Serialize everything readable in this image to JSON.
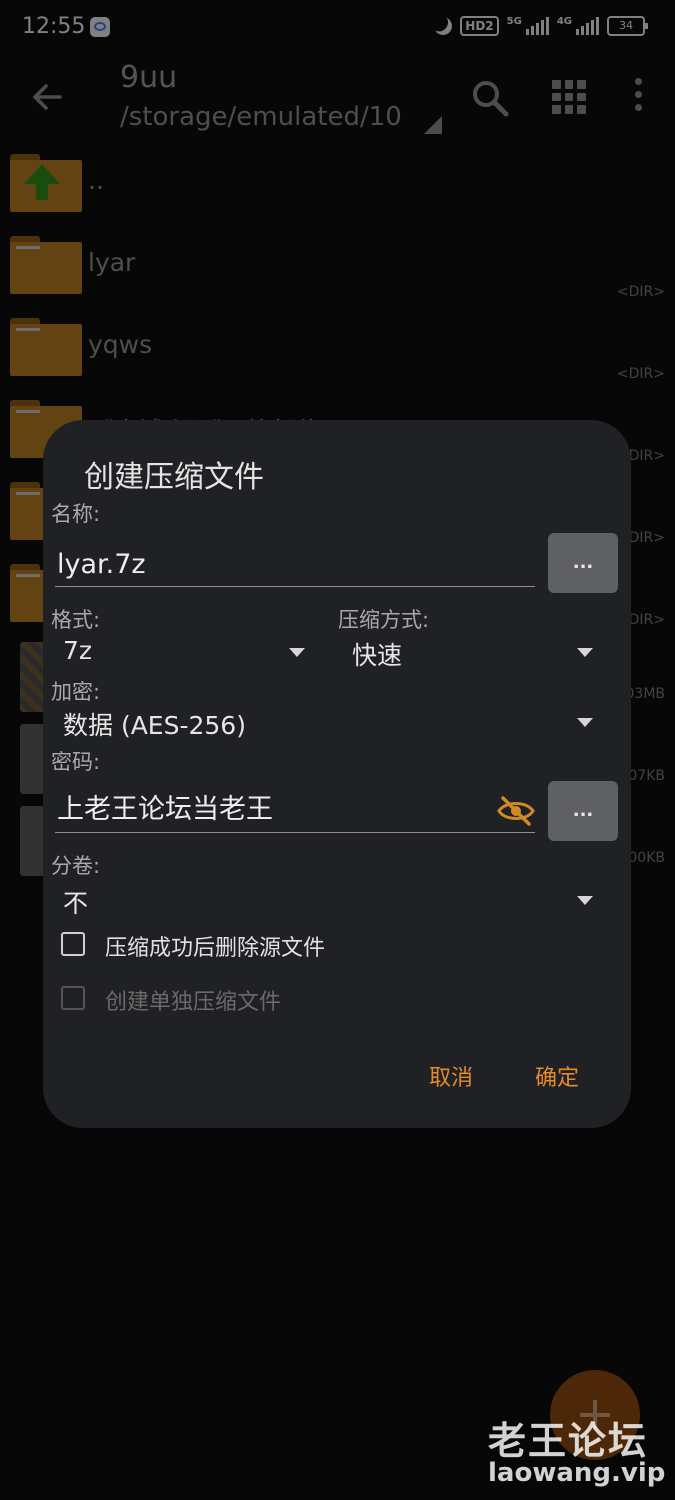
{
  "status_bar": {
    "time": "12:55",
    "hd": "HD2",
    "net1": "5G",
    "net2": "4G",
    "battery": "34"
  },
  "app_bar": {
    "title": "9uu",
    "path": "/storage/emulated/10"
  },
  "files": [
    {
      "name": "..",
      "meta": ""
    },
    {
      "name": "lyar",
      "meta": "<DIR>"
    },
    {
      "name": "yqws",
      "meta": "<DIR>"
    },
    {
      "name": "《魔域小词》 校长传",
      "meta": "<DIR>"
    },
    {
      "name": "",
      "meta": "<DIR>"
    },
    {
      "name": "",
      "meta": "<DIR>"
    },
    {
      "name": "",
      "meta": "03MB"
    },
    {
      "name": "",
      "meta": "07KB"
    },
    {
      "name": "",
      "meta": "00KB"
    }
  ],
  "dialog": {
    "title": "创建压缩文件",
    "name_label": "名称:",
    "name_value": "lyar.7z",
    "browse_button": "...",
    "format_label": "格式:",
    "format_value": "7z",
    "method_label": "压缩方式:",
    "method_value": "快速",
    "encrypt_label": "加密:",
    "encrypt_value": "数据 (AES-256)",
    "password_label": "密码:",
    "password_value": "上老王论坛当老王",
    "password_button": "...",
    "split_label": "分卷:",
    "split_value": "不",
    "delete_source_label": "压缩成功后删除源文件",
    "separate_label": "创建单独压缩文件",
    "cancel": "取消",
    "ok": "确定"
  },
  "watermark": {
    "cn": "老王论坛",
    "en": "laowang.vip"
  },
  "colors": {
    "accent": "#e48a2a",
    "dialog_bg": "#202124",
    "folder": "#b27a20"
  }
}
